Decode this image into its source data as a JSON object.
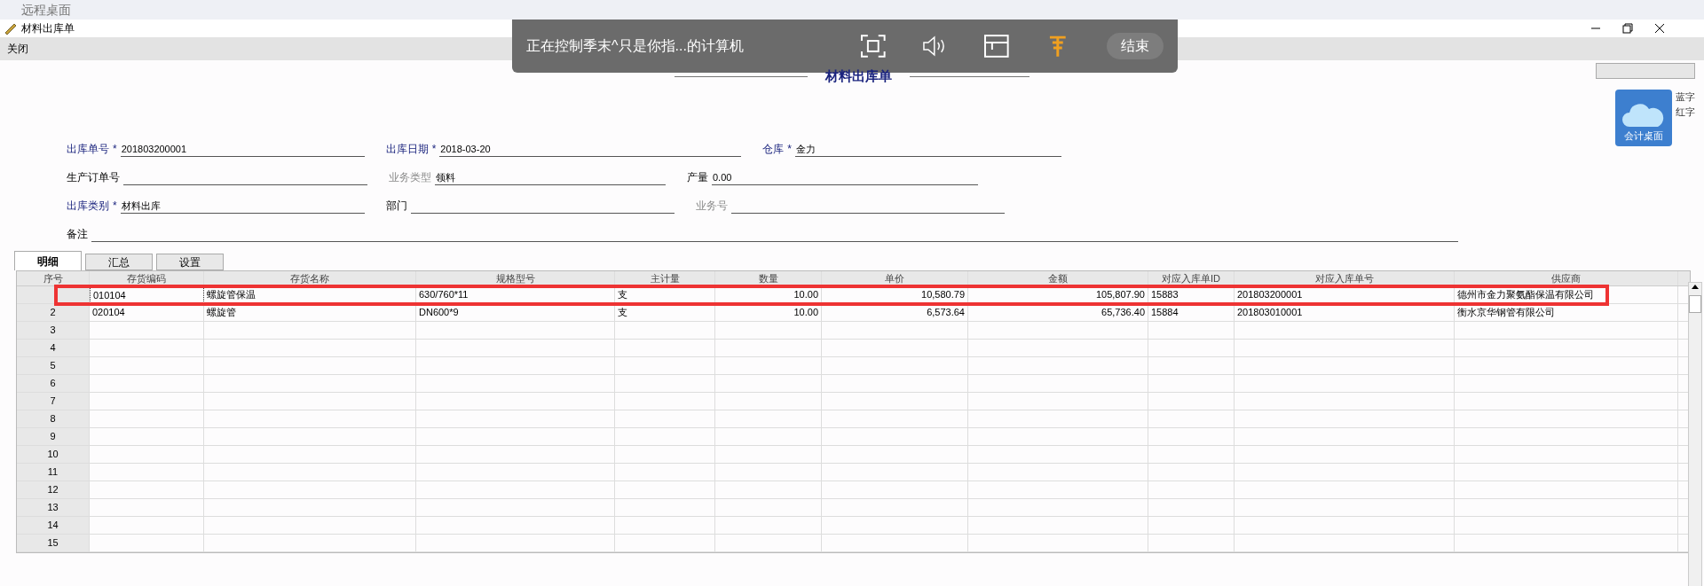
{
  "host_title": "远程桌面",
  "window": {
    "title": "材料出库单"
  },
  "menu": [
    "关闭"
  ],
  "remote_bar": {
    "message": "正在控制季末^只是你指...的计算机",
    "end_button": "结束"
  },
  "form_title": "材料出库单",
  "side": {
    "tile_label": "会计桌面",
    "links": [
      "蓝字",
      "红字"
    ]
  },
  "form_rows": [
    [
      {
        "label": "出库单号",
        "required": true,
        "muted": false,
        "mark": "*",
        "value": "201803200001"
      },
      {
        "label": "出库日期",
        "required": true,
        "muted": false,
        "mark": "*",
        "value": "2018-03-20"
      },
      {
        "label": "仓库",
        "required": true,
        "muted": false,
        "mark": "*",
        "value": "金力"
      }
    ],
    [
      {
        "label": "生产订单号",
        "required": false,
        "muted": false
      },
      {
        "label": "业务类型",
        "required": false,
        "muted": true,
        "value": "领料"
      },
      {
        "label": "产量",
        "required": false,
        "muted": false,
        "value": "0.00"
      }
    ],
    [
      {
        "label": "出库类别",
        "required": true,
        "muted": false,
        "mark": "*",
        "value": "材料出库"
      },
      {
        "label": "部门",
        "required": false,
        "muted": false
      },
      {
        "label": "业务号",
        "required": false,
        "muted": true
      }
    ],
    [
      {
        "label": "备注",
        "required": false,
        "muted": false
      }
    ]
  ],
  "tabs": [
    {
      "label": "明细",
      "selected": true
    },
    {
      "label": "汇总",
      "selected": false
    },
    {
      "label": "设置",
      "selected": false
    }
  ],
  "table": {
    "columns": [
      "序号",
      "存货编码",
      "存货名称",
      "规格型号",
      "主计量",
      "数量",
      "单价",
      "金额",
      "对应入库单ID",
      "对应入库单号",
      "供应商"
    ],
    "rows": [
      {
        "selected": true,
        "cells": [
          "",
          "010104",
          "螺旋管保温",
          "630/760*11",
          "支",
          "10.00",
          "10,580.79",
          "105,807.90",
          "15883",
          "201803200001",
          "德州市金力聚氨酯保温有限公司"
        ]
      },
      {
        "selected": false,
        "cells": [
          "2",
          "020104",
          "螺旋管",
          "DN600*9",
          "支",
          "10.00",
          "6,573.64",
          "65,736.40",
          "15884",
          "201803010001",
          "衡水京华钢管有限公司"
        ]
      },
      {
        "selected": false,
        "cells": [
          "3",
          "",
          "",
          "",
          "",
          "",
          "",
          "",
          "",
          "",
          ""
        ]
      },
      {
        "selected": false,
        "cells": [
          "4",
          "",
          "",
          "",
          "",
          "",
          "",
          "",
          "",
          "",
          ""
        ]
      },
      {
        "selected": false,
        "cells": [
          "5",
          "",
          "",
          "",
          "",
          "",
          "",
          "",
          "",
          "",
          ""
        ]
      },
      {
        "selected": false,
        "cells": [
          "6",
          "",
          "",
          "",
          "",
          "",
          "",
          "",
          "",
          "",
          ""
        ]
      },
      {
        "selected": false,
        "cells": [
          "7",
          "",
          "",
          "",
          "",
          "",
          "",
          "",
          "",
          "",
          ""
        ]
      },
      {
        "selected": false,
        "cells": [
          "8",
          "",
          "",
          "",
          "",
          "",
          "",
          "",
          "",
          "",
          ""
        ]
      },
      {
        "selected": false,
        "cells": [
          "9",
          "",
          "",
          "",
          "",
          "",
          "",
          "",
          "",
          "",
          ""
        ]
      },
      {
        "selected": false,
        "cells": [
          "10",
          "",
          "",
          "",
          "",
          "",
          "",
          "",
          "",
          "",
          ""
        ]
      },
      {
        "selected": false,
        "cells": [
          "11",
          "",
          "",
          "",
          "",
          "",
          "",
          "",
          "",
          "",
          ""
        ]
      },
      {
        "selected": false,
        "cells": [
          "12",
          "",
          "",
          "",
          "",
          "",
          "",
          "",
          "",
          "",
          ""
        ]
      },
      {
        "selected": false,
        "cells": [
          "13",
          "",
          "",
          "",
          "",
          "",
          "",
          "",
          "",
          "",
          ""
        ]
      },
      {
        "selected": false,
        "cells": [
          "14",
          "",
          "",
          "",
          "",
          "",
          "",
          "",
          "",
          "",
          ""
        ]
      },
      {
        "selected": false,
        "cells": [
          "15",
          "",
          "",
          "",
          "",
          "",
          "",
          "",
          "",
          "",
          ""
        ]
      }
    ]
  }
}
